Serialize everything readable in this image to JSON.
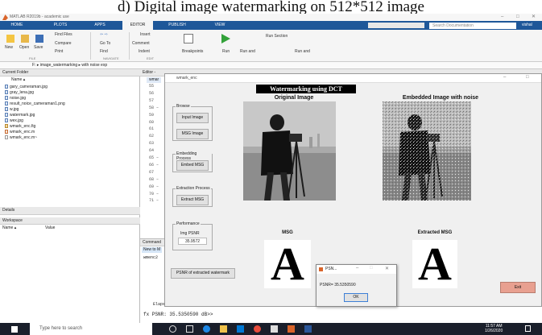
{
  "caption": "d)   Digital image watermarking on 512*512 image",
  "matlab": {
    "window_title": "MATLAB R2019b - academic use",
    "tabs": [
      "HOME",
      "PLOTS",
      "APPS",
      "EDITOR",
      "PUBLISH",
      "VIEW"
    ],
    "search_placeholder": "Search Documentation",
    "user": "vishal",
    "toolstrip": {
      "new": "New",
      "open": "Open",
      "save": "Save",
      "find_files": "Find Files",
      "compare": "Compare",
      "print": "Print",
      "go_to": "Go To",
      "find": "Find",
      "insert": "Insert",
      "comment": "Comment",
      "indent": "Indent",
      "breakpoints": "Breakpoints",
      "run": "Run",
      "run_and": "Run and",
      "run_section": "Run Section",
      "run_and_time": "Run and",
      "sections": [
        "FILE",
        "NAVIGATE",
        "EDIT"
      ]
    },
    "address": "F: ▸ image_watermarking ▸ with noise exp",
    "current_folder": {
      "title": "Current Folder",
      "column": "Name ▴",
      "files": [
        "gary_cameraman.jpg",
        "gray_lena.jpg",
        "noise.jpg",
        "result_noice_cameraman1.png",
        "w.jpg",
        "watermark.jpg",
        "wex.jpg",
        "wmark_enc.fig",
        "wmark_enc.m",
        "wmark_enc.m~"
      ]
    },
    "details_label": "Details",
    "workspace": {
      "title": "Workspace",
      "col_name": "Name ▴",
      "col_value": "Value"
    },
    "editor": {
      "label": "Editor -",
      "tab": "wmar",
      "line_numbers": [
        "55",
        "56",
        "57",
        "58 –",
        "59",
        "60",
        "61",
        "62",
        "63",
        "64",
        "65 –",
        "66 –",
        "67",
        "68 –",
        "69 –",
        "70 –",
        "71 –"
      ]
    },
    "command_window": {
      "title": "Command",
      "tip": "New to M",
      "text1": "wmenc2",
      "elapsed": "Elaps",
      "prompt": "fx PSNR: 35.5350590 dB>>"
    }
  },
  "gui": {
    "title": "wmark_enc",
    "headline": "Watermarking using DCT",
    "original_label": "Original Image",
    "embedded_label": "Embedded Image with noise",
    "msg_label": "MSG",
    "extracted_label": "Extracted MSG",
    "browse": {
      "title": "Browse",
      "input_image": "Input Image",
      "msg_image": "MSG Image"
    },
    "embedding": {
      "title": "Embedding Process",
      "embed": "Embed MSG"
    },
    "extraction": {
      "title": "Extraction Process",
      "extract": "Extract MSG"
    },
    "performance": {
      "title": "Performance",
      "label": "Img PSNR",
      "value": "35.9572"
    },
    "psnr_button": "PSNR of extracted watermark",
    "exit": "Exit",
    "watermark_letter": "A"
  },
  "dialog": {
    "title": "PSN...",
    "message": "PSNR= 35.5350590",
    "ok": "OK"
  },
  "taskbar": {
    "search": "Type here to search",
    "time": "11:57 AM",
    "date": "1/26/2020"
  },
  "colors": {
    "tab_bar": "#1e5799",
    "taskbar": "#1a1f2b",
    "exit_button": "#e8a090"
  }
}
